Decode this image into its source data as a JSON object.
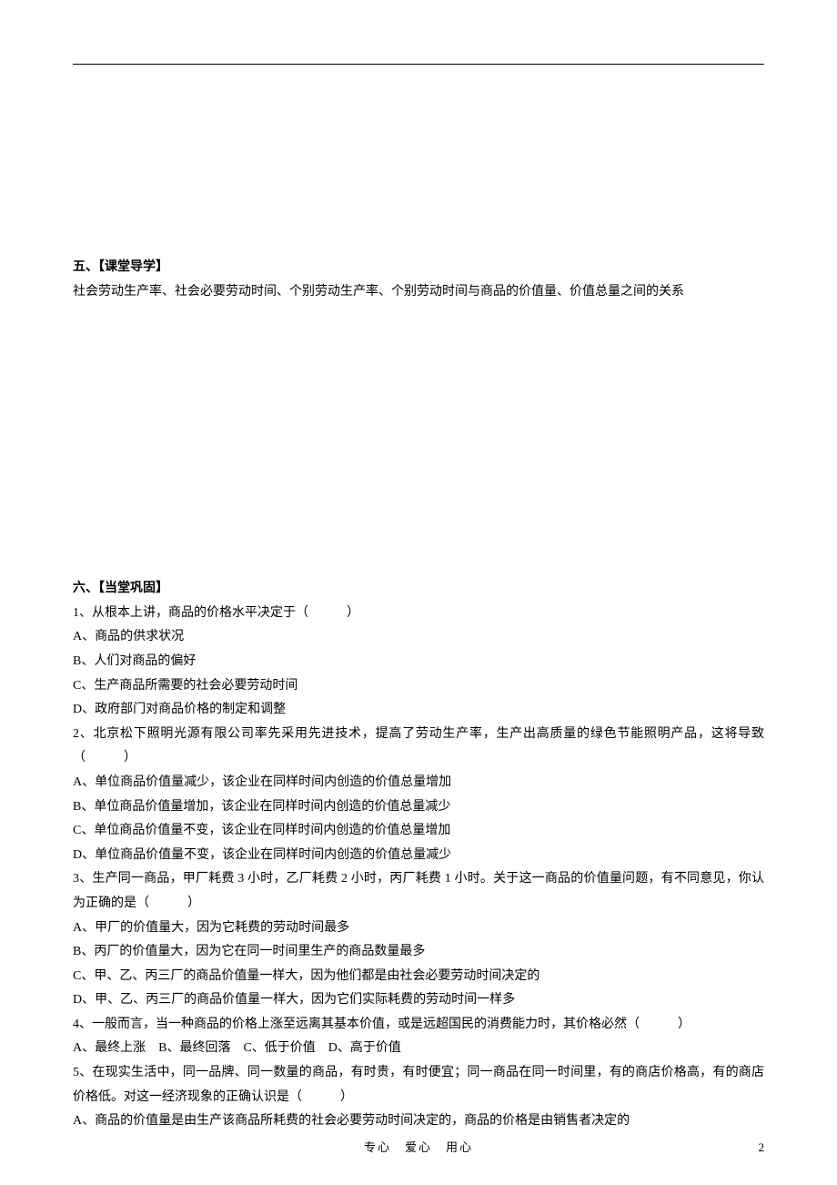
{
  "section5": {
    "heading": "五、【课堂导学】",
    "text": "社会劳动生产率、社会必要劳动时间、个别劳动生产率、个别劳动时间与商品的价值量、价值总量之间的关系"
  },
  "section6": {
    "heading": "六、【当堂巩固】",
    "q1": {
      "stem": "1、从根本上讲，商品的价格水平决定于（　　　）",
      "a": "A、商品的供求状况",
      "b": "B、人们对商品的偏好",
      "c": "C、生产商品所需要的社会必要劳动时间",
      "d": "D、政府部门对商品价格的制定和调整"
    },
    "q2": {
      "stem": "2、北京松下照明光源有限公司率先采用先进技术，提高了劳动生产率，生产出高质量的绿色节能照明产品，这将导致（　　　）",
      "a": "A、单位商品价值量减少，该企业在同样时间内创造的价值总量增加",
      "b": "B、单位商品价值量增加，该企业在同样时间内创造的价值总量减少",
      "c": "C、单位商品价值量不变，该企业在同样时间内创造的价值总量增加",
      "d": "D、单位商品价值量不变，该企业在同样时间内创造的价值总量减少"
    },
    "q3": {
      "stem": "3、生产同一商品，甲厂耗费 3 小时，乙厂耗费 2 小时，丙厂耗费 1 小时。关于这一商品的价值量问题，有不同意见，你认为正确的是（　　　）",
      "a": "A、甲厂的价值量大，因为它耗费的劳动时间最多",
      "b": "B、丙厂的价值量大，因为它在同一时间里生产的商品数量最多",
      "c": "C、甲、乙、丙三厂的商品价值量一样大，因为他们都是由社会必要劳动时间决定的",
      "d": "D、甲、乙、丙三厂的商品价值量一样大，因为它们实际耗费的劳动时间一样多"
    },
    "q4": {
      "stem": "4、一般而言，当一种商品的价格上涨至远离其基本价值，或是远超国民的消费能力时，其价格必然（　　　）",
      "options": "A、最终上涨　B、最终回落　C、低于价值　D、高于价值"
    },
    "q5": {
      "stem": "5、在现实生活中，同一品牌、同一数量的商品，有时贵，有时便宜；同一商品在同一时间里，有的商店价格高，有的商店价格低。对这一经济现象的正确认识是（　　　）",
      "a": "A、商品的价值量是由生产该商品所耗费的社会必要劳动时间决定的，商品的价格是由销售者决定的"
    }
  },
  "footer": {
    "motto": "专心　爱心　用心",
    "page": "2"
  }
}
